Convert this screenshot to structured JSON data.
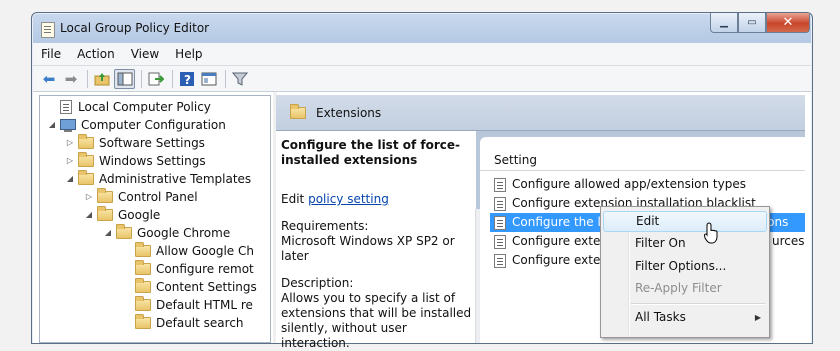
{
  "window": {
    "title": "Local Group Policy Editor",
    "min": "▁",
    "max": "▭",
    "close": "✕"
  },
  "menu": [
    "File",
    "Action",
    "View",
    "Help"
  ],
  "toolbar": {
    "icons": [
      "back-arrow-icon",
      "forward-arrow-icon",
      "up-folder-icon",
      "show-hide-tree-icon",
      "export-list-icon",
      "help-icon",
      "properties-icon",
      "filter-icon"
    ]
  },
  "tree": [
    {
      "label": "Local Computer Policy",
      "icon": "doc-icon",
      "twisty": ""
    },
    {
      "label": "Computer Configuration",
      "icon": "computer-icon",
      "twisty": "◢"
    },
    {
      "label": "Software Settings",
      "icon": "folder-icon",
      "twisty": "▷"
    },
    {
      "label": "Windows Settings",
      "icon": "folder-icon",
      "twisty": "▷"
    },
    {
      "label": "Administrative Templates",
      "icon": "folder-icon",
      "twisty": "◢"
    },
    {
      "label": "Control Panel",
      "icon": "folder-icon",
      "twisty": "▷"
    },
    {
      "label": "Google",
      "icon": "folder-icon",
      "twisty": "◢"
    },
    {
      "label": "Google Chrome",
      "icon": "folder-icon",
      "twisty": "◢"
    },
    {
      "label": "Allow Google Ch",
      "icon": "folder-icon",
      "twisty": ""
    },
    {
      "label": "Configure remot",
      "icon": "folder-icon",
      "twisty": ""
    },
    {
      "label": "Content Settings",
      "icon": "folder-icon",
      "twisty": ""
    },
    {
      "label": "Default HTML re",
      "icon": "folder-icon",
      "twisty": ""
    },
    {
      "label": "Default search",
      "icon": "folder-icon",
      "twisty": ""
    }
  ],
  "extensions_header": "Extensions",
  "description": {
    "heading": "Configure the list of force-installed extensions",
    "edit_prefix": "Edit",
    "edit_link": "policy setting",
    "requirements_label": "Requirements:",
    "requirements_value": "Microsoft Windows XP SP2 or later",
    "description_label": "Description:",
    "description_value": "Allows you to specify a list of extensions that will be installed silently, without user interaction."
  },
  "settings_list": {
    "column": "Setting",
    "rows": [
      "Configure allowed app/extension types",
      "Configure extension installation blacklist",
      "Configure the list of force-installed extensions",
      "Configure extensi",
      "Configure extensi"
    ],
    "selected_index": 2,
    "row4_tail": "urces"
  },
  "context_menu": {
    "items": [
      {
        "label": "Edit",
        "state": "hover"
      },
      {
        "label": "Filter On",
        "state": "normal"
      },
      {
        "label": "Filter Options...",
        "state": "normal"
      },
      {
        "label": "Re-Apply Filter",
        "state": "disabled"
      },
      {
        "label": "All Tasks",
        "state": "submenu"
      }
    ]
  }
}
